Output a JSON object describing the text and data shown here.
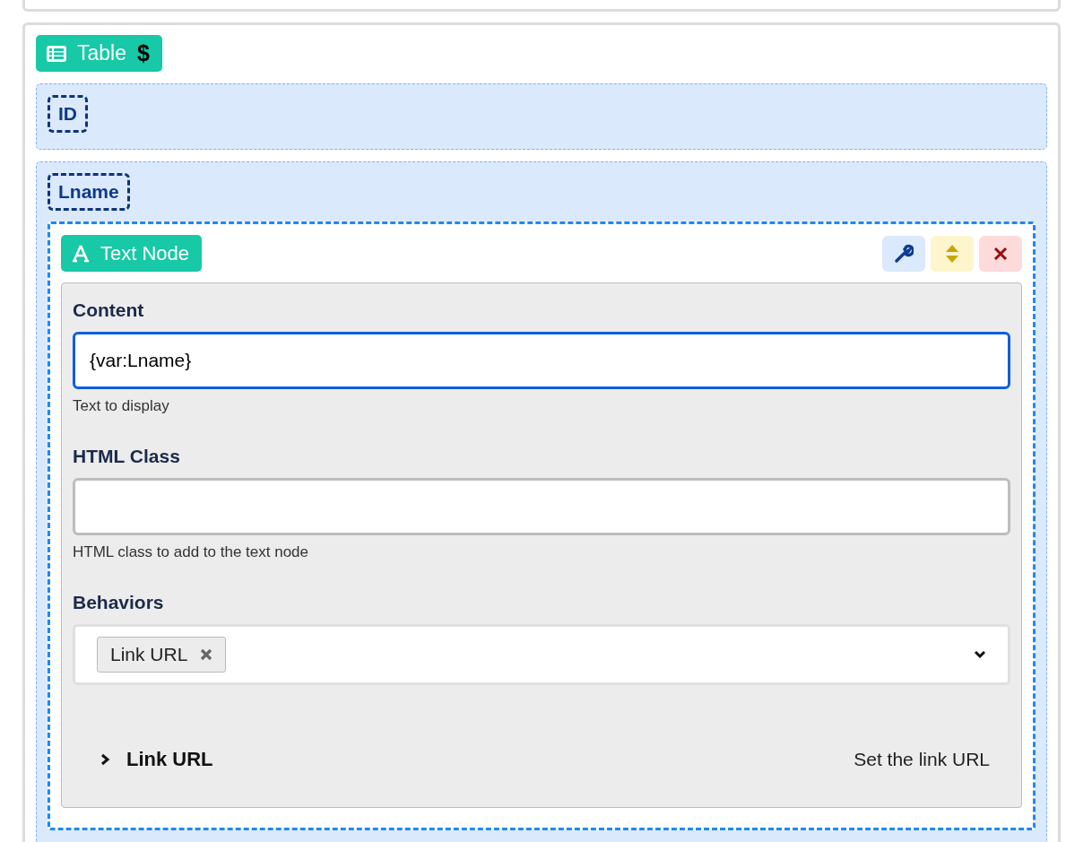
{
  "table": {
    "label": "Table",
    "suffix": "$"
  },
  "columns": [
    {
      "name": "ID"
    },
    {
      "name": "Lname",
      "children": [
        {
          "label": "Text Node",
          "fields": [
            {
              "kind": "text",
              "label": "Content",
              "value": "{var:Lname}",
              "focused": true,
              "help": "Text to display"
            },
            {
              "kind": "text",
              "label": "HTML Class",
              "focused": false,
              "help": "HTML class to add to the text node"
            },
            {
              "kind": "multiselect",
              "label": "Behaviors",
              "chips": [
                "Link URL"
              ]
            }
          ],
          "sections": [
            {
              "title": "Link URL",
              "description": "Set the link URL",
              "expanded": false
            }
          ]
        }
      ]
    }
  ]
}
